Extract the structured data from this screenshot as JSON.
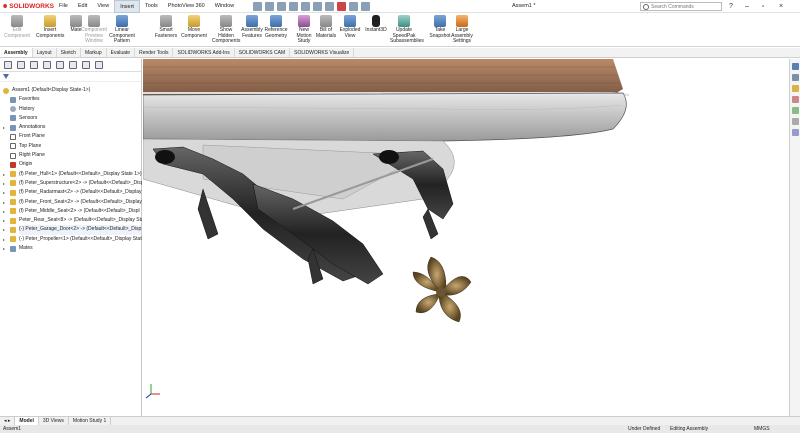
{
  "app": {
    "brand": "SOLIDWORKS",
    "title": "Assem1 *",
    "search_placeholder": "Search Commands"
  },
  "menu": [
    "File",
    "Edit",
    "View",
    "Insert",
    "Tools",
    "PhotoView 360",
    "Window"
  ],
  "ribbon": [
    {
      "l1": "Edit",
      "l2": "Component",
      "dis": true,
      "icon": "edit-component-icon",
      "c": "g"
    },
    {
      "l1": "Insert",
      "l2": "Components",
      "icon": "insert-components-icon",
      "c": "y"
    },
    {
      "l1": "Mate",
      "l2": "",
      "icon": "mate-icon",
      "c": "g"
    },
    {
      "l1": "Component",
      "l2": "Preview",
      "l3": "Window",
      "dis": true,
      "icon": "component-preview-icon",
      "c": "g"
    },
    {
      "l1": "Linear Component",
      "l2": "Pattern",
      "icon": "linear-pattern-icon",
      "c": "b"
    },
    {
      "l1": "Smart",
      "l2": "Fasteners",
      "icon": "smart-fasteners-icon",
      "c": "g"
    },
    {
      "l1": "Move",
      "l2": "Component",
      "icon": "move-component-icon",
      "c": "y"
    },
    {
      "l1": "Show",
      "l2": "Hidden",
      "l3": "Components",
      "icon": "show-hidden-icon",
      "c": "g"
    },
    {
      "l1": "Assembly",
      "l2": "Features",
      "icon": "assembly-features-icon",
      "c": "b"
    },
    {
      "l1": "Reference",
      "l2": "Geometry",
      "icon": "reference-geometry-icon",
      "c": "b"
    },
    {
      "l1": "New",
      "l2": "Motion",
      "l3": "Study",
      "icon": "motion-study-icon",
      "c": "p"
    },
    {
      "l1": "Bill of",
      "l2": "Materials",
      "icon": "bom-icon",
      "c": "g"
    },
    {
      "l1": "Exploded",
      "l2": "View",
      "icon": "exploded-view-icon",
      "c": "b"
    },
    {
      "l1": "Instant3D",
      "l2": "",
      "icon": "instant3d-icon",
      "c": "k"
    },
    {
      "l1": "Update",
      "l2": "SpeedPak",
      "l3": "Subassemblies",
      "icon": "speedpak-icon",
      "c": "t"
    },
    {
      "l1": "Take",
      "l2": "Snapshot",
      "icon": "snapshot-icon",
      "c": "b"
    },
    {
      "l1": "Large",
      "l2": "Assembly",
      "l3": "Settings",
      "icon": "large-assembly-icon",
      "c": "o"
    }
  ],
  "tabs": [
    "Assembly",
    "Layout",
    "Sketch",
    "Markup",
    "Evaluate",
    "Render Tools",
    "SOLIDWORKS Add-Ins",
    "SOLIDWORKS CAM",
    "SOLIDWORKS Visualize"
  ],
  "tree": [
    {
      "label": "Assem1  (Default<Display State-1>)",
      "lvl": 0,
      "t": "asm"
    },
    {
      "label": "Favorites",
      "lvl": 1,
      "t": "fold"
    },
    {
      "label": "History",
      "lvl": 1,
      "t": "hist"
    },
    {
      "label": "Sensors",
      "lvl": 1,
      "t": "fold"
    },
    {
      "label": "Annotations",
      "lvl": 1,
      "t": "fold",
      "ex": true
    },
    {
      "label": "Front Plane",
      "lvl": 1,
      "t": "plane"
    },
    {
      "label": "Top Plane",
      "lvl": 1,
      "t": "plane"
    },
    {
      "label": "Right Plane",
      "lvl": 1,
      "t": "plane"
    },
    {
      "label": "Origin",
      "lvl": 1,
      "t": "orig"
    },
    {
      "label": "(f) Peter_Hull<1> (Default<<Default>_Display State 1>)",
      "lvl": 1,
      "t": "part",
      "ex": true
    },
    {
      "label": "(f) Peter_Superstructure<2> -> (Default<<Default>_Displ",
      "lvl": 1,
      "t": "part",
      "ex": true
    },
    {
      "label": "(f) Peter_Radarmast<2> -> (Default<<Default>_Display",
      "lvl": 1,
      "t": "part",
      "ex": true
    },
    {
      "label": "(f) Peter_Front_Seat<2> -> (Default<<Default>_Display",
      "lvl": 1,
      "t": "part",
      "ex": true
    },
    {
      "label": "(f) Peter_Middle_Seat<2> -> (Default<<Default>_Displ",
      "lvl": 1,
      "t": "part",
      "ex": true
    },
    {
      "label": "Peter_Rear_Seat<8> -> (Default<<Default>_Display Stat",
      "lvl": 1,
      "t": "part",
      "ex": true
    },
    {
      "label": "(-) Peter_Garage_Door<2> -> (Default<<Default>_Disp",
      "lvl": 1,
      "t": "part",
      "ex": true,
      "hl": true
    },
    {
      "label": "(-) Peter_Propeller<1> (Default<<Default>_Display State",
      "lvl": 1,
      "t": "part",
      "ex": true
    },
    {
      "label": "Mates",
      "lvl": 1,
      "t": "fold",
      "ex": true
    }
  ],
  "bottom_tabs": [
    "Model",
    "3D Views",
    "Motion Study 1"
  ],
  "status": {
    "left": "Assem1",
    "s1": "Under Defined",
    "s2": "Editing Assembly",
    "s3": "MMGS"
  }
}
